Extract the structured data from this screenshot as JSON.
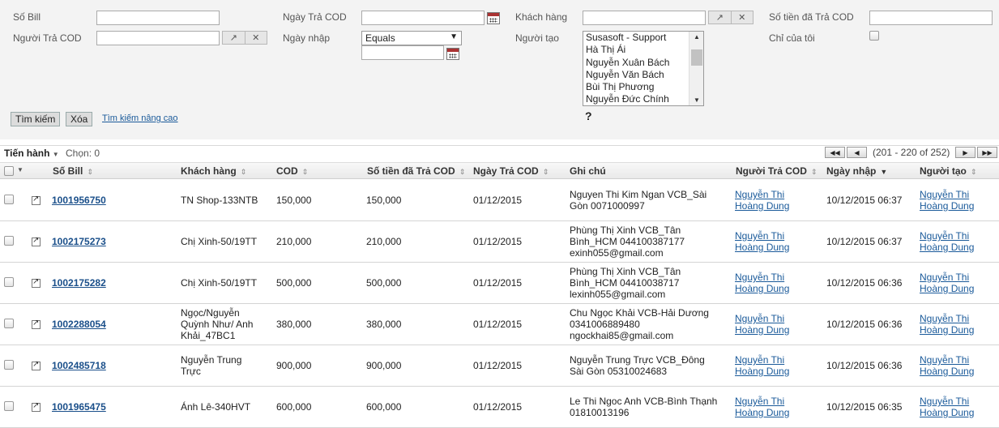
{
  "filters": {
    "so_bill_label": "Số Bill",
    "nguoi_tra_cod_label": "Người Trả COD",
    "ngay_tra_cod_label": "Ngày Trả COD",
    "ngay_nhap_label": "Ngày nhập",
    "ngay_nhap_operator": "Equals",
    "khach_hang_label": "Khách hàng",
    "nguoi_tao_label": "Người tạo",
    "nguoi_tao_options": [
      "Susasoft - Support",
      "Hà Thị Ái",
      "Nguyễn Xuân Bách",
      "Nguyễn Văn Bách",
      "Bùi Thị Phương",
      "Nguyễn Đức Chính"
    ],
    "so_tien_label": "Số tiền đã Trả COD",
    "chi_cua_toi_label": "Chỉ của tôi",
    "help": "?"
  },
  "buttons": {
    "search": "Tìm kiếm",
    "clear": "Xóa",
    "advanced": "Tìm kiếm nâng cao"
  },
  "toolbar": {
    "action": "Tiến hành",
    "selected": "Chọn: 0",
    "pager": "(201 - 220 of 252)"
  },
  "columns": {
    "so_bill": "Số Bill",
    "khach_hang": "Khách hàng",
    "cod": "COD",
    "so_tien": "Số tiền đã Trả COD",
    "ngay_tra": "Ngày Trả COD",
    "ghi_chu": "Ghi chú",
    "nguoi_tra": "Người Trả COD",
    "ngay_nhap": "Ngày nhập",
    "nguoi_tao": "Người tạo"
  },
  "rows": [
    {
      "bill": "1001956750",
      "khach": [
        "TN Shop-133NTB"
      ],
      "cod": "150,000",
      "tien": "150,000",
      "ngay_tra": "01/12/2015",
      "ghi": [
        "Nguyen Thi Kim Ngan VCB_Sài",
        "Gòn 0071000997"
      ],
      "nguoi_tra": [
        "Nguyễn Thi",
        "Hoàng Dung"
      ],
      "ngay_nhap": "10/12/2015 06:37",
      "nguoi_tao": [
        "Nguyễn Thi",
        "Hoàng Dung"
      ]
    },
    {
      "bill": "1002175273",
      "khach": [
        "Chị Xinh-50/19TT"
      ],
      "cod": "210,000",
      "tien": "210,000",
      "ngay_tra": "01/12/2015",
      "ghi": [
        "Phùng Thị Xinh VCB_Tân",
        "Bình_HCM 044100387177",
        " exinh055@gmail.com"
      ],
      "nguoi_tra": [
        "Nguyễn Thi",
        "Hoàng Dung"
      ],
      "ngay_nhap": "10/12/2015 06:37",
      "nguoi_tao": [
        "Nguyễn Thi",
        "Hoàng Dung"
      ]
    },
    {
      "bill": "1002175282",
      "khach": [
        "Chị Xinh-50/19TT"
      ],
      "cod": "500,000",
      "tien": "500,000",
      "ngay_tra": "01/12/2015",
      "ghi": [
        "Phùng Thị Xinh VCB_Tân",
        "Bình_HCM 04410038717",
        "lexinh055@gmail.com"
      ],
      "nguoi_tra": [
        "Nguyễn Thi",
        "Hoàng Dung"
      ],
      "ngay_nhap": "10/12/2015 06:36",
      "nguoi_tao": [
        "Nguyễn Thi",
        "Hoàng Dung"
      ]
    },
    {
      "bill": "1002288054",
      "khach": [
        "Ngọc/Nguyễn",
        "Quỳnh Như/ Anh",
        "Khải_47BC1"
      ],
      "cod": "380,000",
      "tien": "380,000",
      "ngay_tra": "01/12/2015",
      "ghi": [
        "Chu Ngọc Khải VCB-Hải Dương",
        "0341006889480",
        "ngockhai85@gmail.com"
      ],
      "nguoi_tra": [
        "Nguyễn Thi",
        "Hoàng Dung"
      ],
      "ngay_nhap": "10/12/2015 06:36",
      "nguoi_tao": [
        "Nguyễn Thi",
        "Hoàng Dung"
      ]
    },
    {
      "bill": "1002485718",
      "khach": [
        "Nguyễn Trung",
        "Trực"
      ],
      "cod": "900,000",
      "tien": "900,000",
      "ngay_tra": "01/12/2015",
      "ghi": [
        "Nguyễn Trung Trực VCB_Đông",
        "Sài Gòn 05310024683"
      ],
      "nguoi_tra": [
        "Nguyễn Thi",
        "Hoàng Dung"
      ],
      "ngay_nhap": "10/12/2015 06:36",
      "nguoi_tao": [
        "Nguyễn Thi",
        "Hoàng Dung"
      ]
    },
    {
      "bill": "1001965475",
      "khach": [
        "Ánh Lê-340HVT"
      ],
      "cod": "600,000",
      "tien": "600,000",
      "ngay_tra": "01/12/2015",
      "ghi": [
        "Le Thi Ngoc Anh VCB-Bình Thạnh",
        "01810013196"
      ],
      "nguoi_tra": [
        "Nguyễn Thi",
        "Hoàng Dung"
      ],
      "ngay_nhap": "10/12/2015 06:35",
      "nguoi_tao": [
        "Nguyễn Thi",
        "Hoàng Dung"
      ]
    }
  ]
}
